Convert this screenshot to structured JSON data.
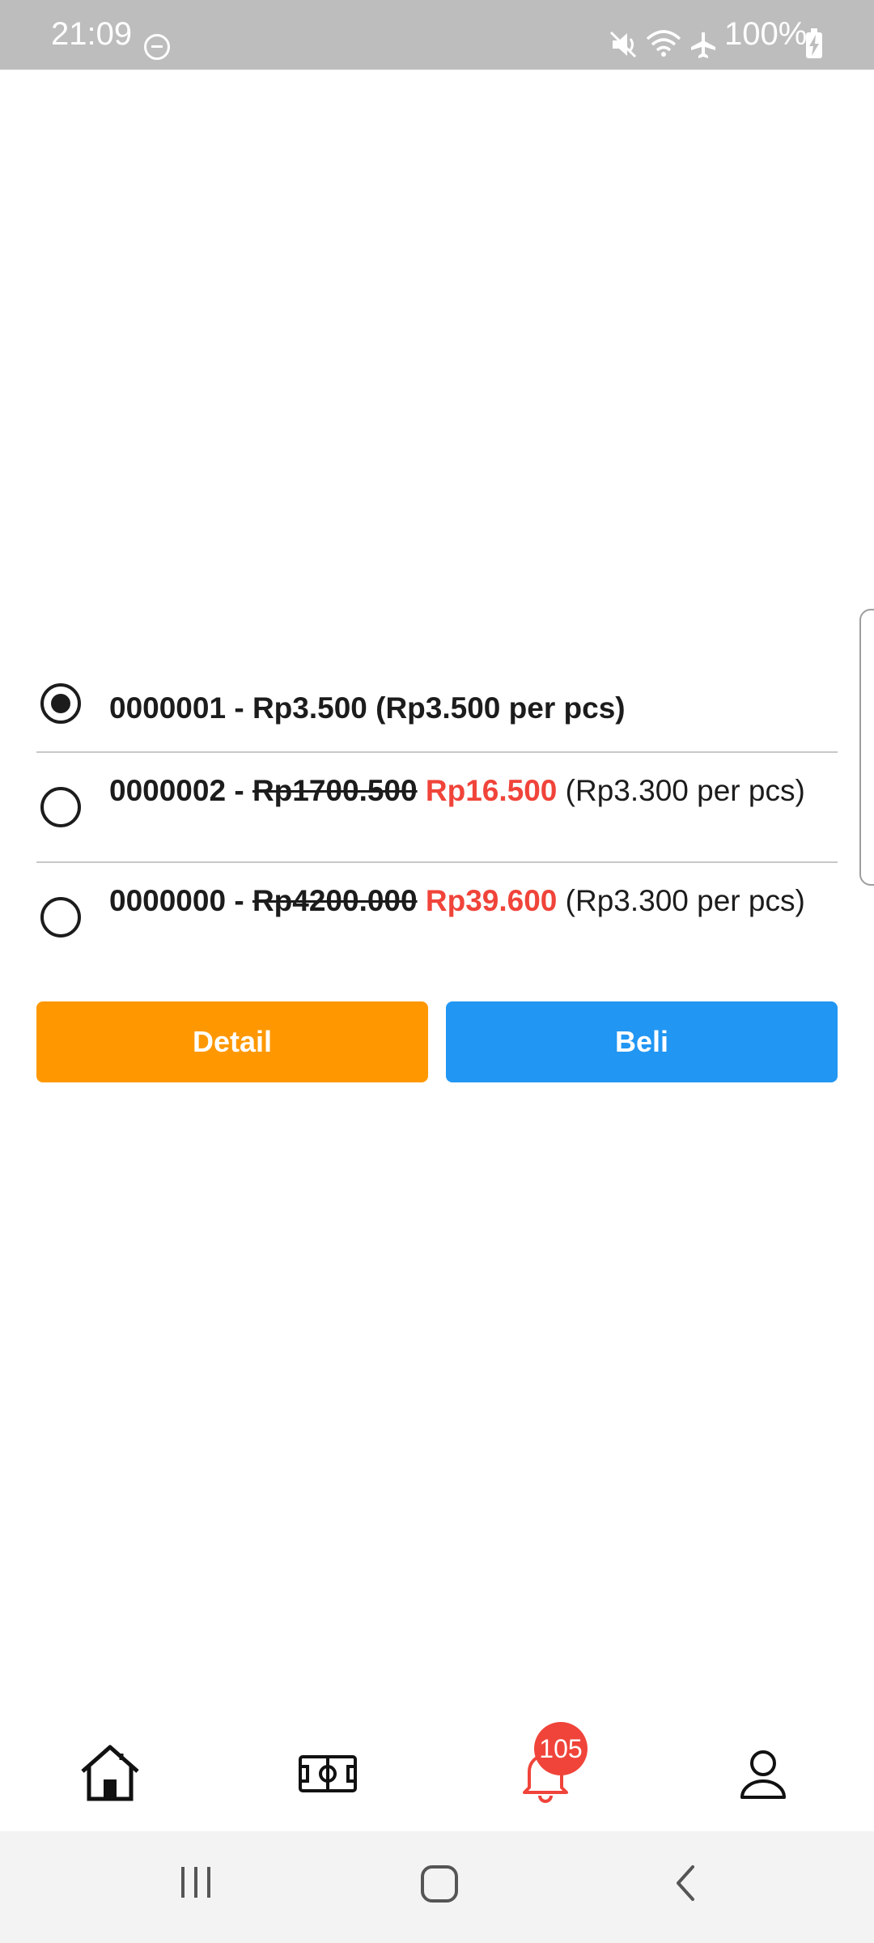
{
  "status_bar": {
    "time": "21:09",
    "battery": "100%",
    "icons": [
      "do-not-disturb-icon",
      "mute-icon",
      "wifi-icon",
      "airplane-icon",
      "battery-charging-icon"
    ]
  },
  "options": [
    {
      "id": "0000001",
      "separator": " - ",
      "price": "Rp3.500",
      "unit_note": "(Rp3.500 per pcs)",
      "selected": true
    },
    {
      "id": "0000002",
      "separator": " - ",
      "original_price": "Rp1700.500",
      "price": "Rp16.500",
      "unit_note": "(Rp3.300 per pcs)",
      "selected": false
    },
    {
      "id": "0000000",
      "separator": " - ",
      "original_price": "Rp4200.000",
      "price": "Rp39.600",
      "unit_note": "(Rp3.300 per pcs)",
      "selected": false
    }
  ],
  "actions": {
    "detail_label": "Detail",
    "buy_label": "Beli",
    "detail_color": "#ff9800",
    "buy_color": "#2196f3"
  },
  "bottom_nav": {
    "items": [
      "home-icon",
      "field-icon",
      "bell-icon",
      "profile-icon"
    ],
    "notification_badge": "105",
    "active_color": "#f0443a"
  },
  "system_nav": [
    "recent-apps-icon",
    "home-icon",
    "back-icon"
  ]
}
